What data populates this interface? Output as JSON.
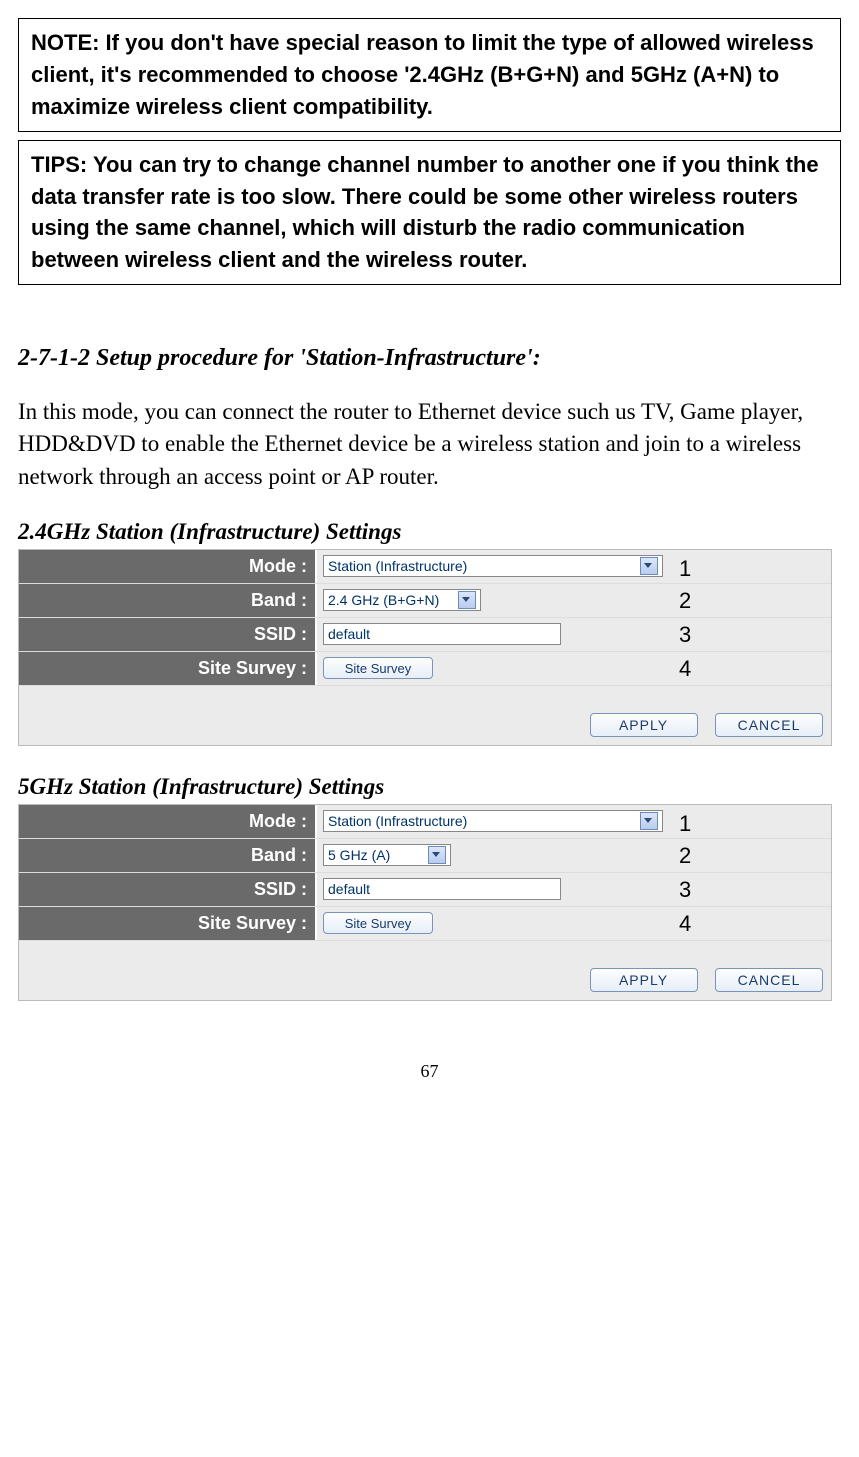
{
  "note_box": "NOTE: If you don't have special reason to limit the type of allowed wireless client, it's recommended to choose '2.4GHz (B+G+N) and 5GHz (A+N) to maximize wireless client compatibility.",
  "tips_box": "TIPS: You can try to change channel number to another one if you think the data transfer rate is too slow. There could be some other wireless routers using the same channel, which will disturb the radio communication between wireless client and the wireless router.",
  "section_title": "2-7-1-2 Setup procedure for 'Station-Infrastructure':",
  "intro_text": "In this mode, you can connect the router to Ethernet device such us TV, Game player, HDD&DVD to enable the Ethernet device be a wireless station and join to a wireless network through an access point or AP router.",
  "panel24": {
    "title": "2.4GHz Station (Infrastructure) Settings",
    "rows": {
      "mode": {
        "label": "Mode :",
        "value": "Station (Infrastructure)"
      },
      "band": {
        "label": "Band :",
        "value": "2.4 GHz (B+G+N)"
      },
      "ssid": {
        "label": "SSID :",
        "value": "default"
      },
      "survey": {
        "label": "Site Survey :",
        "button": "Site Survey"
      }
    },
    "apply": "APPLY",
    "cancel": "CANCEL",
    "callouts": [
      "1",
      "2",
      "3",
      "4"
    ]
  },
  "panel5": {
    "title": "5GHz Station (Infrastructure) Settings",
    "rows": {
      "mode": {
        "label": "Mode :",
        "value": "Station (Infrastructure)"
      },
      "band": {
        "label": "Band :",
        "value": "5 GHz (A)"
      },
      "ssid": {
        "label": "SSID :",
        "value": "default"
      },
      "survey": {
        "label": "Site Survey :",
        "button": "Site Survey"
      }
    },
    "apply": "APPLY",
    "cancel": "CANCEL",
    "callouts": [
      "1",
      "2",
      "3",
      "4"
    ]
  },
  "page_number": "67"
}
